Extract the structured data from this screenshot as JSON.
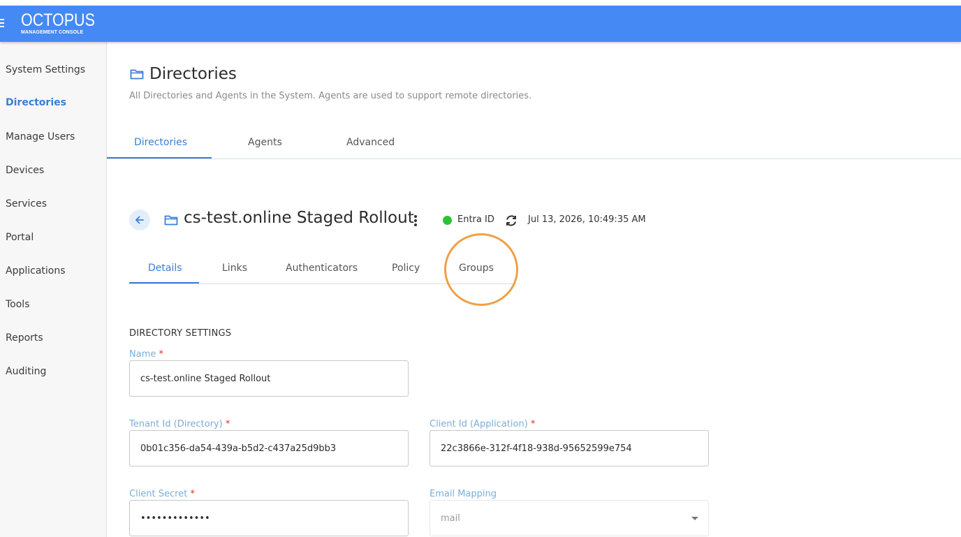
{
  "app": {
    "logo_title": "OCTOPUS",
    "logo_subtitle": "MANAGEMENT CONSOLE"
  },
  "sidebar": {
    "items": [
      {
        "label": "System Settings"
      },
      {
        "label": "Directories",
        "active": true
      },
      {
        "label": "Manage Users"
      },
      {
        "label": "Devices"
      },
      {
        "label": "Services"
      },
      {
        "label": "Portal"
      },
      {
        "label": "Applications"
      },
      {
        "label": "Tools"
      },
      {
        "label": "Reports"
      },
      {
        "label": "Auditing"
      }
    ]
  },
  "page": {
    "title": "Directories",
    "description": "All Directories and Agents in the System. Agents are used to support remote directories.",
    "tabs": [
      {
        "label": "Directories",
        "active": true
      },
      {
        "label": "Agents"
      },
      {
        "label": "Advanced"
      }
    ]
  },
  "directory": {
    "name": "cs-test.online Staged Rollout",
    "type": "Entra ID",
    "status_color": "#2ec233",
    "last_sync": "Jul 13, 2026, 10:49:35 AM",
    "tabs": [
      {
        "label": "Details",
        "active": true
      },
      {
        "label": "Links"
      },
      {
        "label": "Authenticators"
      },
      {
        "label": "Policy"
      },
      {
        "label": "Groups",
        "highlighted": true
      }
    ]
  },
  "settings": {
    "section_title": "DIRECTORY SETTINGS",
    "required_mark": "*",
    "name": {
      "label": "Name",
      "value": "cs-test.online Staged Rollout"
    },
    "tenant_id": {
      "label": "Tenant Id (Directory)",
      "value": "0b01c356-da54-439a-b5d2-c437a25d9bb3"
    },
    "client_id": {
      "label": "Client Id (Application)",
      "value": "22c3866e-312f-4f18-938d-95652599e754"
    },
    "client_secret": {
      "label": "Client Secret",
      "value": "•••••••••••••"
    },
    "email_mapping": {
      "label": "Email Mapping",
      "value": "mail"
    }
  },
  "colors": {
    "header_bg": "#4589f5",
    "accent": "#3a7fd5",
    "highlight_ring": "#f0a045"
  }
}
